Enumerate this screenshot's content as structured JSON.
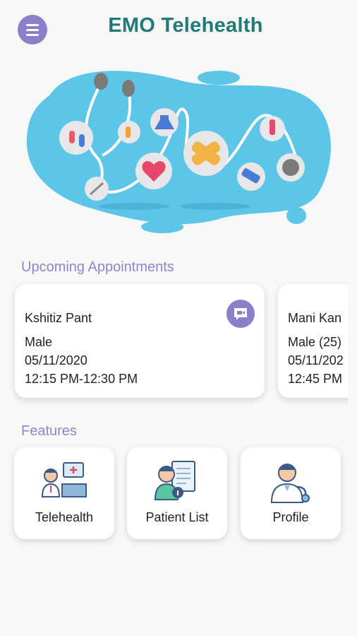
{
  "app": {
    "title": "EMO Telehealth"
  },
  "header": {
    "menu_icon": "hamburger-menu-icon"
  },
  "sections": {
    "appointments_title": "Upcoming Appointments",
    "features_title": "Features"
  },
  "appointments": [
    {
      "name": "Kshitiz Pant",
      "gender": "Male",
      "date": "05/11/2020",
      "time": "12:15 PM-12:30 PM",
      "action_icon": "video-call-icon"
    },
    {
      "name": "Mani Kan",
      "gender": "Male (25)",
      "date": "05/11/202",
      "time": "12:45 PM"
    }
  ],
  "features": [
    {
      "label": "Telehealth",
      "icon": "doctor-desk-icon"
    },
    {
      "label": "Patient List",
      "icon": "patient-record-icon"
    },
    {
      "label": "Profile",
      "icon": "doctor-stethoscope-icon"
    }
  ],
  "colors": {
    "accent": "#8a80c9",
    "title": "#1f7a78",
    "hero_blob": "#5cc6e8",
    "section_title": "#8f86cf"
  }
}
